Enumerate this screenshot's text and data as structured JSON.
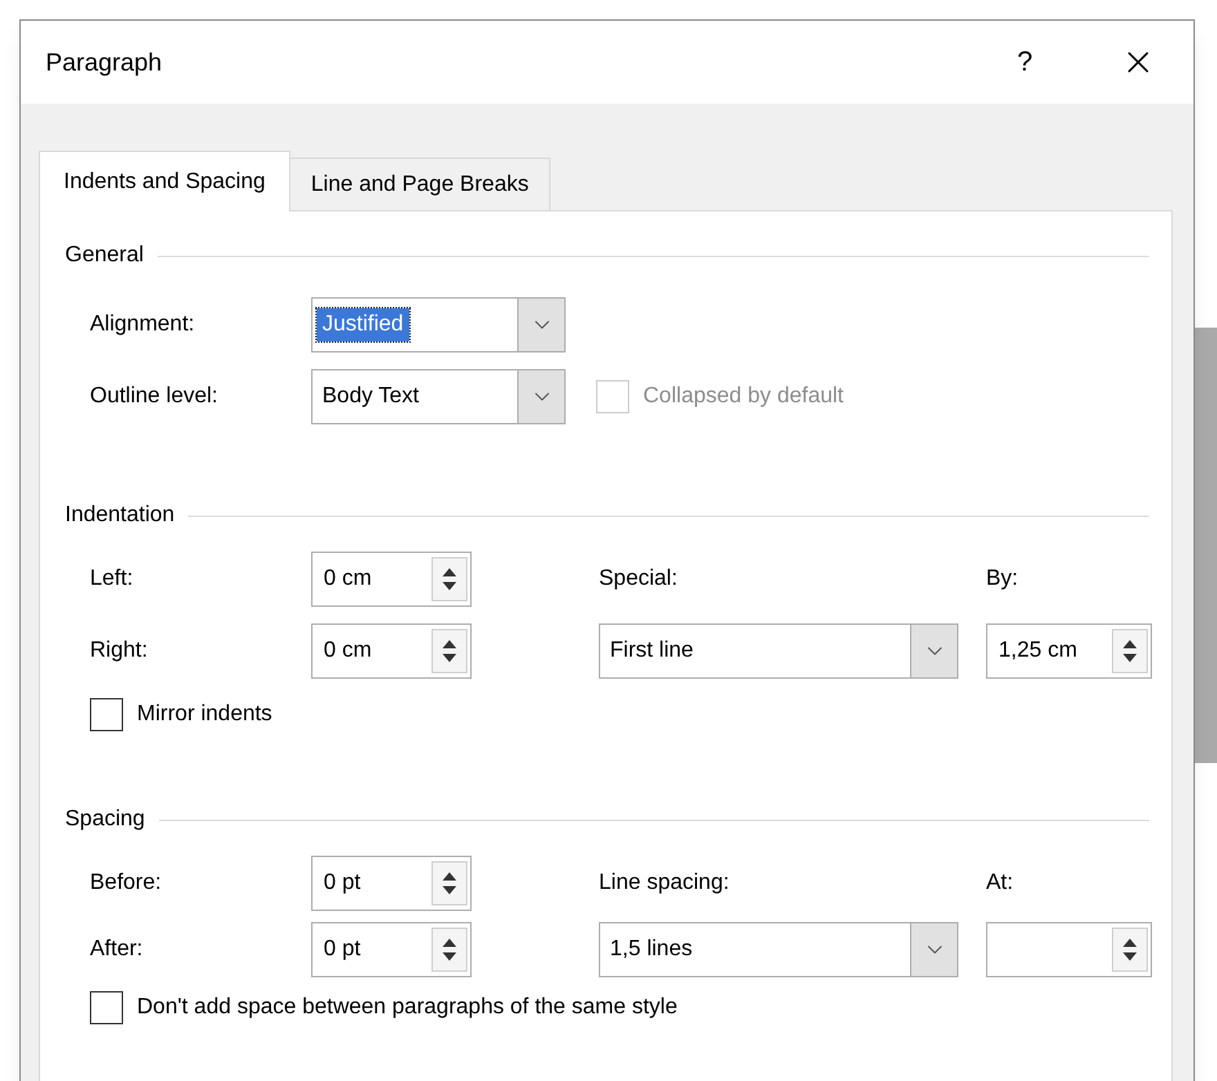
{
  "dialog": {
    "title": "Paragraph",
    "help": "?",
    "tabs": [
      {
        "label": "Indents and Spacing",
        "selected": true
      },
      {
        "label": "Line and Page Breaks",
        "selected": false
      }
    ],
    "general": {
      "heading": "General",
      "alignment": {
        "label": "Alignment:",
        "value": "Justified",
        "highlighted": true
      },
      "outline_level": {
        "label": "Outline level:",
        "value": "Body Text",
        "highlighted": false
      },
      "collapsed": {
        "label": "Collapsed by default",
        "checked": false,
        "disabled": true
      }
    },
    "indentation": {
      "heading": "Indentation",
      "left": {
        "label": "Left:",
        "value": "0 cm"
      },
      "right": {
        "label": "Right:",
        "value": "0 cm"
      },
      "special": {
        "label": "Special:",
        "value": "First line"
      },
      "by": {
        "label": "By:",
        "value": "1,25 cm"
      },
      "mirror": {
        "label": "Mirror indents",
        "checked": false,
        "disabled": false
      }
    },
    "spacing": {
      "heading": "Spacing",
      "before": {
        "label": "Before:",
        "value": "0 pt"
      },
      "after": {
        "label": "After:",
        "value": "0 pt"
      },
      "line_spacing": {
        "label": "Line spacing:",
        "value": "1,5 lines"
      },
      "at": {
        "label": "At:"
      },
      "dont_add": {
        "label": "Don't add space between paragraphs of the same style",
        "checked": false,
        "disabled": false
      }
    }
  }
}
